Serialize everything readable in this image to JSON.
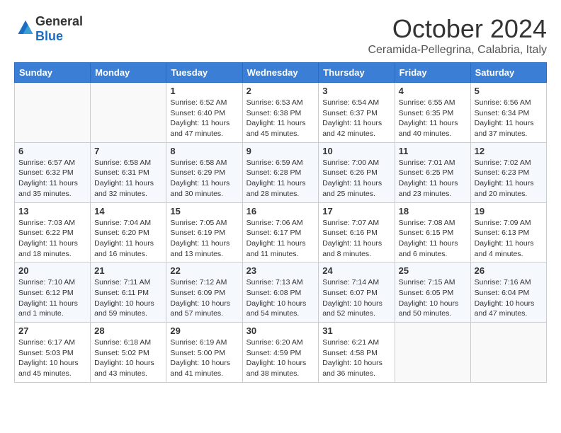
{
  "logo": {
    "general": "General",
    "blue": "Blue"
  },
  "header": {
    "month": "October 2024",
    "location": "Ceramida-Pellegrina, Calabria, Italy"
  },
  "weekdays": [
    "Sunday",
    "Monday",
    "Tuesday",
    "Wednesday",
    "Thursday",
    "Friday",
    "Saturday"
  ],
  "weeks": [
    [
      {
        "day": "",
        "detail": ""
      },
      {
        "day": "",
        "detail": ""
      },
      {
        "day": "1",
        "detail": "Sunrise: 6:52 AM\nSunset: 6:40 PM\nDaylight: 11 hours and 47 minutes."
      },
      {
        "day": "2",
        "detail": "Sunrise: 6:53 AM\nSunset: 6:38 PM\nDaylight: 11 hours and 45 minutes."
      },
      {
        "day": "3",
        "detail": "Sunrise: 6:54 AM\nSunset: 6:37 PM\nDaylight: 11 hours and 42 minutes."
      },
      {
        "day": "4",
        "detail": "Sunrise: 6:55 AM\nSunset: 6:35 PM\nDaylight: 11 hours and 40 minutes."
      },
      {
        "day": "5",
        "detail": "Sunrise: 6:56 AM\nSunset: 6:34 PM\nDaylight: 11 hours and 37 minutes."
      }
    ],
    [
      {
        "day": "6",
        "detail": "Sunrise: 6:57 AM\nSunset: 6:32 PM\nDaylight: 11 hours and 35 minutes."
      },
      {
        "day": "7",
        "detail": "Sunrise: 6:58 AM\nSunset: 6:31 PM\nDaylight: 11 hours and 32 minutes."
      },
      {
        "day": "8",
        "detail": "Sunrise: 6:58 AM\nSunset: 6:29 PM\nDaylight: 11 hours and 30 minutes."
      },
      {
        "day": "9",
        "detail": "Sunrise: 6:59 AM\nSunset: 6:28 PM\nDaylight: 11 hours and 28 minutes."
      },
      {
        "day": "10",
        "detail": "Sunrise: 7:00 AM\nSunset: 6:26 PM\nDaylight: 11 hours and 25 minutes."
      },
      {
        "day": "11",
        "detail": "Sunrise: 7:01 AM\nSunset: 6:25 PM\nDaylight: 11 hours and 23 minutes."
      },
      {
        "day": "12",
        "detail": "Sunrise: 7:02 AM\nSunset: 6:23 PM\nDaylight: 11 hours and 20 minutes."
      }
    ],
    [
      {
        "day": "13",
        "detail": "Sunrise: 7:03 AM\nSunset: 6:22 PM\nDaylight: 11 hours and 18 minutes."
      },
      {
        "day": "14",
        "detail": "Sunrise: 7:04 AM\nSunset: 6:20 PM\nDaylight: 11 hours and 16 minutes."
      },
      {
        "day": "15",
        "detail": "Sunrise: 7:05 AM\nSunset: 6:19 PM\nDaylight: 11 hours and 13 minutes."
      },
      {
        "day": "16",
        "detail": "Sunrise: 7:06 AM\nSunset: 6:17 PM\nDaylight: 11 hours and 11 minutes."
      },
      {
        "day": "17",
        "detail": "Sunrise: 7:07 AM\nSunset: 6:16 PM\nDaylight: 11 hours and 8 minutes."
      },
      {
        "day": "18",
        "detail": "Sunrise: 7:08 AM\nSunset: 6:15 PM\nDaylight: 11 hours and 6 minutes."
      },
      {
        "day": "19",
        "detail": "Sunrise: 7:09 AM\nSunset: 6:13 PM\nDaylight: 11 hours and 4 minutes."
      }
    ],
    [
      {
        "day": "20",
        "detail": "Sunrise: 7:10 AM\nSunset: 6:12 PM\nDaylight: 11 hours and 1 minute."
      },
      {
        "day": "21",
        "detail": "Sunrise: 7:11 AM\nSunset: 6:11 PM\nDaylight: 10 hours and 59 minutes."
      },
      {
        "day": "22",
        "detail": "Sunrise: 7:12 AM\nSunset: 6:09 PM\nDaylight: 10 hours and 57 minutes."
      },
      {
        "day": "23",
        "detail": "Sunrise: 7:13 AM\nSunset: 6:08 PM\nDaylight: 10 hours and 54 minutes."
      },
      {
        "day": "24",
        "detail": "Sunrise: 7:14 AM\nSunset: 6:07 PM\nDaylight: 10 hours and 52 minutes."
      },
      {
        "day": "25",
        "detail": "Sunrise: 7:15 AM\nSunset: 6:05 PM\nDaylight: 10 hours and 50 minutes."
      },
      {
        "day": "26",
        "detail": "Sunrise: 7:16 AM\nSunset: 6:04 PM\nDaylight: 10 hours and 47 minutes."
      }
    ],
    [
      {
        "day": "27",
        "detail": "Sunrise: 6:17 AM\nSunset: 5:03 PM\nDaylight: 10 hours and 45 minutes."
      },
      {
        "day": "28",
        "detail": "Sunrise: 6:18 AM\nSunset: 5:02 PM\nDaylight: 10 hours and 43 minutes."
      },
      {
        "day": "29",
        "detail": "Sunrise: 6:19 AM\nSunset: 5:00 PM\nDaylight: 10 hours and 41 minutes."
      },
      {
        "day": "30",
        "detail": "Sunrise: 6:20 AM\nSunset: 4:59 PM\nDaylight: 10 hours and 38 minutes."
      },
      {
        "day": "31",
        "detail": "Sunrise: 6:21 AM\nSunset: 4:58 PM\nDaylight: 10 hours and 36 minutes."
      },
      {
        "day": "",
        "detail": ""
      },
      {
        "day": "",
        "detail": ""
      }
    ]
  ]
}
